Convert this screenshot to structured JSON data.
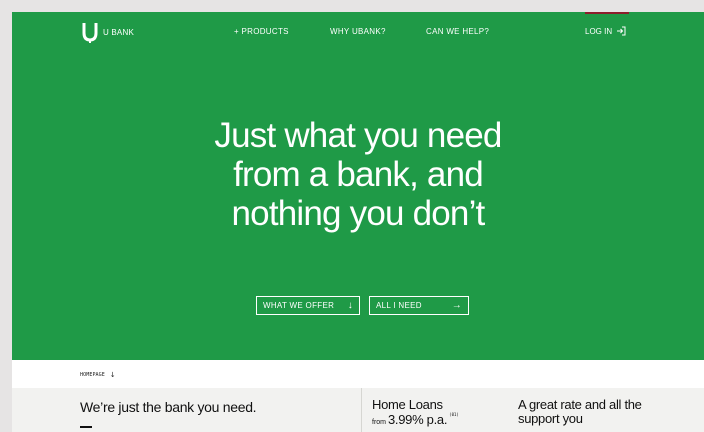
{
  "colors": {
    "brand_green": "#1f9a47",
    "login_accent": "#8b1e2b",
    "page_background": "#f2f2f0",
    "outer_background": "#e6e4e4"
  },
  "nav": {
    "brand_name": "U BANK",
    "brand_icon": "u-logo-icon",
    "links": [
      {
        "label": "+ PRODUCTS"
      },
      {
        "label": "WHY UBANK?"
      },
      {
        "label": "CAN WE HELP?"
      }
    ],
    "login": {
      "label": "LOG IN",
      "icon": "login-icon"
    }
  },
  "hero": {
    "headline": [
      "Just what you need",
      "from a bank, and",
      "nothing you don’t"
    ],
    "ctas": [
      {
        "label": "WHAT WE OFFER",
        "icon": "arrow-down-icon",
        "glyph": "↓"
      },
      {
        "label": "ALL I NEED",
        "icon": "arrow-right-icon",
        "glyph": "→"
      }
    ]
  },
  "breadcrumb": {
    "label": "HOMEPAGE",
    "glyph": "↓"
  },
  "intro": {
    "lede": "We’re just the bank you need."
  },
  "home_loans": {
    "title": "Home Loans",
    "from": "from",
    "rate": "3.99% p.a.",
    "ref": "(01)"
  },
  "promo": {
    "text": "A great rate and all the support you"
  }
}
